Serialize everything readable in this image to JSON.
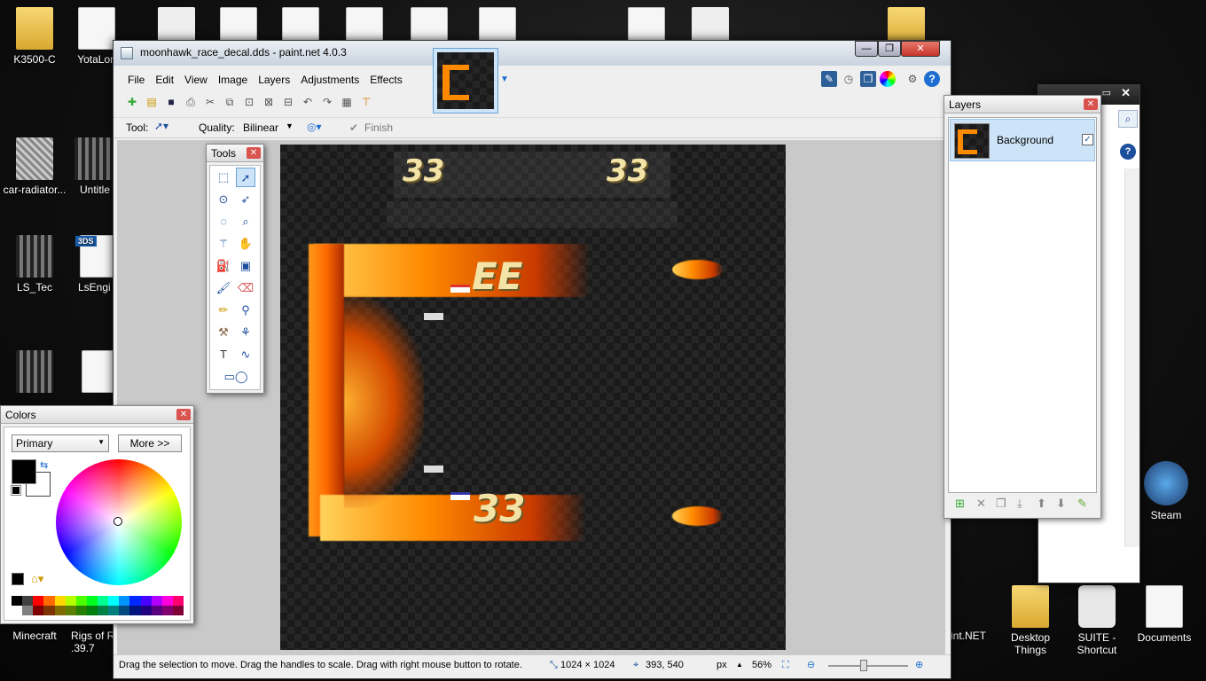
{
  "desktop": {
    "icons": [
      {
        "label": "K3500-C",
        "kind": "folder"
      },
      {
        "label": "YotaLon",
        "kind": "paper"
      },
      {
        "label": "car-radiator...",
        "kind": "img1"
      },
      {
        "label": "Untitle",
        "kind": "img2"
      },
      {
        "label": "LS_Tec",
        "kind": "img2"
      },
      {
        "label": "LsEngi",
        "kind": "paper"
      },
      {
        "label": "Minecraft",
        "kind": "none"
      },
      {
        "label": "Rigs of R .39.7",
        "kind": "none"
      },
      {
        "label": "Steam",
        "kind": "img3"
      },
      {
        "label": "Desktop Things",
        "kind": "folder"
      },
      {
        "label": "SUITE - Shortcut",
        "kind": "paper"
      },
      {
        "label": "Documents",
        "kind": "paper"
      },
      {
        "label": "int.NET",
        "kind": "none"
      }
    ],
    "badge_3ds": "3DS"
  },
  "main_window": {
    "title": "moonhawk_race_decal.dds - paint.net 4.0.3",
    "menu": [
      "File",
      "Edit",
      "View",
      "Image",
      "Layers",
      "Adjustments",
      "Effects"
    ],
    "tool_label": "Tool:",
    "quality_label": "Quality:",
    "quality_value": "Bilinear",
    "finish_label": "Finish",
    "min_glyph": "—",
    "max_glyph": "❐",
    "close_glyph": "✕"
  },
  "canvas": {
    "numbers": [
      "33",
      "33",
      "EE",
      "33"
    ]
  },
  "tools_panel": {
    "title": "Tools",
    "close": "✕"
  },
  "colors_panel": {
    "title": "Colors",
    "close": "✕",
    "mode_value": "Primary",
    "more_button": "More >>",
    "primary_color": "#000000",
    "secondary_color": "#ffffff",
    "palette": [
      "#000000",
      "#404040",
      "#ff0000",
      "#ff6a00",
      "#ffd800",
      "#b6ff00",
      "#4cff00",
      "#00ff21",
      "#00ff90",
      "#00ffff",
      "#0094ff",
      "#0026ff",
      "#4800ff",
      "#b200ff",
      "#ff00dc",
      "#ff006e",
      "#ffffff",
      "#808080",
      "#7f0000",
      "#7f3300",
      "#7f6a00",
      "#5b7f00",
      "#267f00",
      "#007f0e",
      "#007f46",
      "#007f7f",
      "#004a7f",
      "#00137f",
      "#21007f",
      "#57007f",
      "#7f006e",
      "#7f0037"
    ]
  },
  "layers_panel": {
    "title": "Layers",
    "close": "✕",
    "layer_name": "Background"
  },
  "status_bar": {
    "message": "Drag the selection to move. Drag the handles to scale. Drag with right mouse button to rotate.",
    "image_size": "1024 × 1024",
    "cursor_pos": "393, 540",
    "unit": "px",
    "zoom": "56%"
  }
}
